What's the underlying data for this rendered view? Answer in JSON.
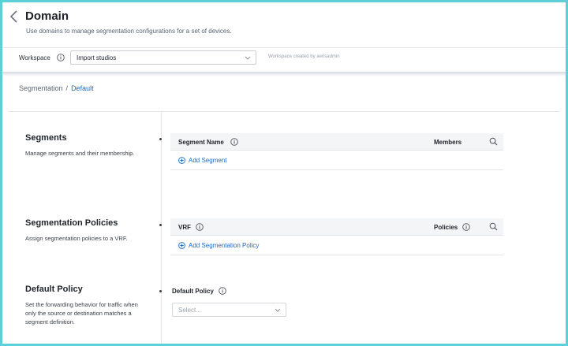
{
  "header": {
    "title": "Domain",
    "subtitle": "Use domains to manage segmentation configurations for a set of devices."
  },
  "workspace": {
    "label": "Workspace",
    "selected": "Import studios",
    "meta": "Workspace created by aerisadmin"
  },
  "breadcrumb": {
    "root": "Segmentation",
    "separator": "/",
    "current": "Default"
  },
  "segments": {
    "title": "Segments",
    "description": "Manage segments and their membership.",
    "columns": [
      "Segment Name",
      "Members"
    ],
    "add_label": "Add Segment"
  },
  "policies": {
    "title": "Segmentation Policies",
    "description": "Assign segmentation policies to a VRF.",
    "columns": [
      "VRF",
      "Policies"
    ],
    "add_label": "Add Segmentation Policy"
  },
  "default_policy": {
    "title": "Default Policy",
    "description": "Set the forwarding behavior for traffic when only the source or destination matches a segment definition.",
    "field_label": "Default Policy",
    "placeholder": "Select..."
  },
  "colors": {
    "accent": "#1a6bc5",
    "frame_border": "#5ccfd9"
  }
}
